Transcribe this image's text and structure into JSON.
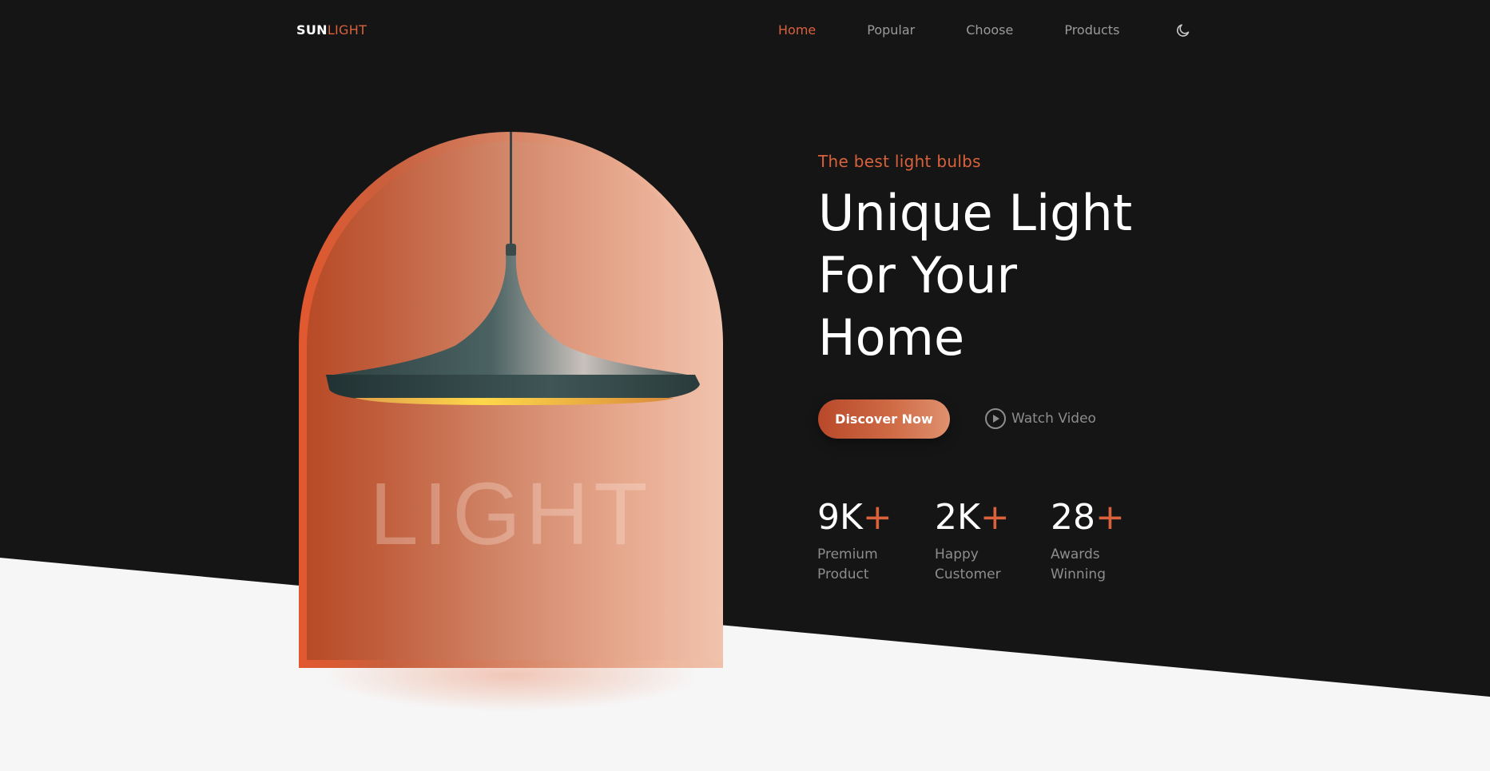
{
  "brand": {
    "logo_main": "SUN",
    "logo_accent": "LIGHT"
  },
  "nav": {
    "items": [
      {
        "label": "Home",
        "active": true
      },
      {
        "label": "Popular",
        "active": false
      },
      {
        "label": "Choose",
        "active": false
      },
      {
        "label": "Products",
        "active": false
      }
    ],
    "theme_toggle_icon": "moon-icon"
  },
  "hero": {
    "image_word": "LIGHT",
    "subtitle": "The best light bulbs",
    "title_lines": [
      "Unique Light",
      "For Your",
      "Home"
    ],
    "primary_button": "Discover Now",
    "secondary_button": "Watch Video",
    "secondary_icon": "play-circle-icon"
  },
  "stats": [
    {
      "value": "9K",
      "suffix": "+",
      "label_lines": [
        "Premium",
        "Product"
      ]
    },
    {
      "value": "2K",
      "suffix": "+",
      "label_lines": [
        "Happy",
        "Customer"
      ]
    },
    {
      "value": "28",
      "suffix": "+",
      "label_lines": [
        "Awards",
        "Winning"
      ]
    }
  ],
  "colors": {
    "accent": "#d9623c",
    "background_dark": "#151515",
    "background_light": "#f6f6f6"
  }
}
